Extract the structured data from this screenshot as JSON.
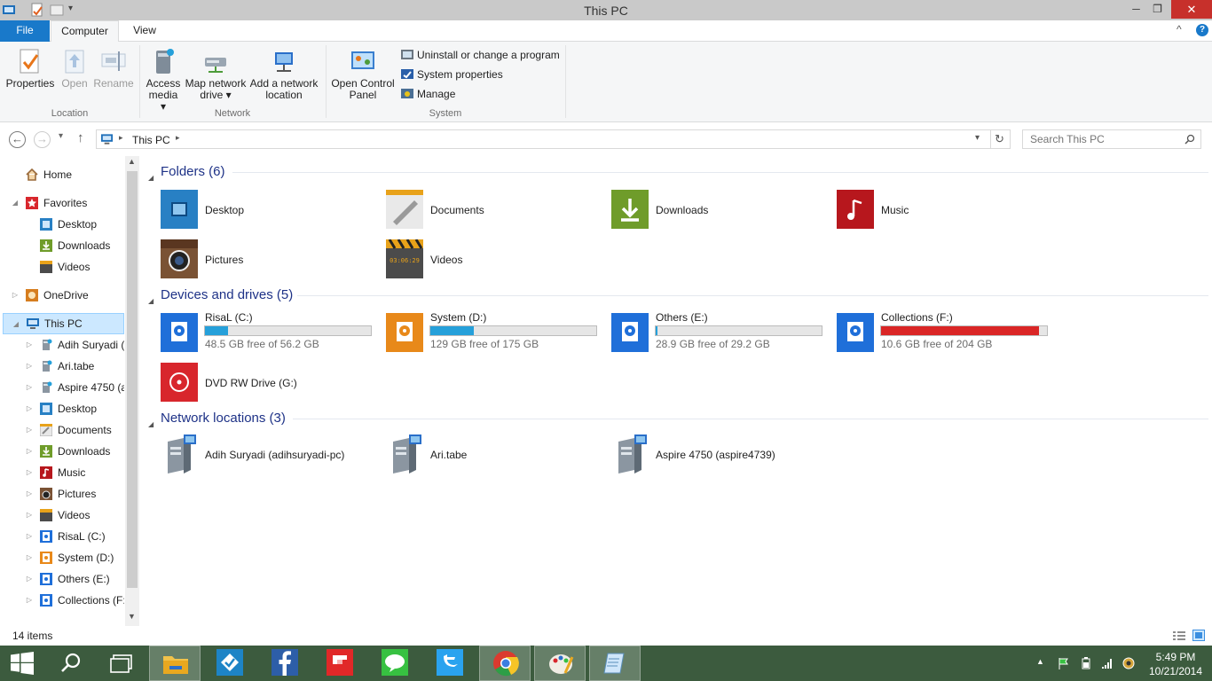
{
  "window": {
    "title": "This PC",
    "minimize": "─",
    "maximize": "❐",
    "close": "✕",
    "help": "?",
    "collapse": "^"
  },
  "ribbon_tabs": {
    "file": "File",
    "computer": "Computer",
    "view": "View"
  },
  "ribbon": {
    "location": {
      "group": "Location",
      "properties": "Properties",
      "open": "Open",
      "rename": "Rename"
    },
    "network": {
      "group": "Network",
      "access_media_1": "Access",
      "access_media_2": "media ▾",
      "map_drive_1": "Map network",
      "map_drive_2": "drive ▾",
      "add_location_1": "Add a network",
      "add_location_2": "location"
    },
    "system": {
      "group": "System",
      "control_panel_1": "Open Control",
      "control_panel_2": "Panel",
      "uninstall": "Uninstall or change a program",
      "sys_props": "System properties",
      "manage": "Manage"
    }
  },
  "nav": {
    "back": "←",
    "forward": "→",
    "up": "↑",
    "dropdown": "⌄",
    "address": "This PC",
    "search_placeholder": "Search This PC"
  },
  "sidebar": {
    "home": "Home",
    "favorites": "Favorites",
    "fav_desktop": "Desktop",
    "fav_downloads": "Downloads",
    "fav_videos": "Videos",
    "onedrive": "OneDrive",
    "thispc": "This PC",
    "pc_items": [
      "Adih Suryadi (",
      "Ari.tabe",
      "Aspire 4750 (as",
      "Desktop",
      "Documents",
      "Downloads",
      "Music",
      "Pictures",
      "Videos",
      "RisaL (C:)",
      "System (D:)",
      "Others (E:)",
      "Collections (F:"
    ]
  },
  "sections": {
    "folders": "Folders (6)",
    "devices": "Devices and drives (5)",
    "network": "Network locations (3)"
  },
  "folders": [
    "Desktop",
    "Documents",
    "Downloads",
    "Music",
    "Pictures",
    "Videos"
  ],
  "drives": [
    {
      "name": "RisaL (C:)",
      "free": "48.5 GB free of 56.2 GB",
      "used_fraction": 0.14,
      "color": "#26a0da"
    },
    {
      "name": "System (D:)",
      "free": "129 GB free of 175 GB",
      "used_fraction": 0.26,
      "color": "#26a0da"
    },
    {
      "name": "Others (E:)",
      "free": "28.9 GB free of 29.2 GB",
      "used_fraction": 0.01,
      "color": "#26a0da"
    },
    {
      "name": "Collections (F:)",
      "free": "10.6 GB free of 204 GB",
      "used_fraction": 0.95,
      "color": "#da2626"
    }
  ],
  "dvd": "DVD RW Drive (G:)",
  "network_locations": [
    "Adih Suryadi (adihsuryadi-pc)",
    "Ari.tabe",
    "Aspire 4750 (aspire4739)"
  ],
  "status": {
    "items": "14 items"
  },
  "clock": {
    "time": "5:49 PM",
    "date": "10/21/2014"
  },
  "colors": {
    "accent": "#1979ca",
    "taskbar": "#3c5b3e",
    "selection": "#cce8ff",
    "section": "#1e3287"
  }
}
